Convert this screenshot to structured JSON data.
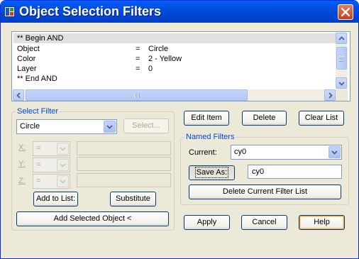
{
  "window": {
    "title": "Object Selection Filters"
  },
  "filter_list": {
    "rows": [
      {
        "field": "** Begin  AND",
        "op": "",
        "value": "",
        "selected": true
      },
      {
        "field": "Object",
        "op": "=",
        "value": "Circle",
        "selected": false
      },
      {
        "field": "Color",
        "op": "=",
        "value": "2 - Yellow",
        "selected": false
      },
      {
        "field": "Layer",
        "op": "=",
        "value": "0",
        "selected": false
      },
      {
        "field": "** End    AND",
        "op": "",
        "value": "",
        "selected": false
      }
    ]
  },
  "select_filter": {
    "label": "Select Filter",
    "type_value": "Circle",
    "select_button": "Select...",
    "coords": [
      {
        "axis": "X:",
        "op": "="
      },
      {
        "axis": "Y:",
        "op": "="
      },
      {
        "axis": "Z:",
        "op": "="
      }
    ],
    "add_to_list": "Add to List:",
    "substitute": "Substitute",
    "add_selected_object": "Add Selected Object <"
  },
  "list_buttons": {
    "edit_item": "Edit Item",
    "delete": "Delete",
    "clear_list": "Clear List"
  },
  "named_filters": {
    "label": "Named Filters",
    "current_label": "Current:",
    "current_value": "cy0",
    "save_as": "Save As:",
    "save_as_value": "cy0",
    "delete_current": "Delete Current Filter List"
  },
  "dialog_buttons": {
    "apply": "Apply",
    "cancel": "Cancel",
    "help": "Help"
  },
  "colors": {
    "title_bar": "#0054e3",
    "group_label": "#0046d5",
    "close_button": "#d4502c"
  }
}
